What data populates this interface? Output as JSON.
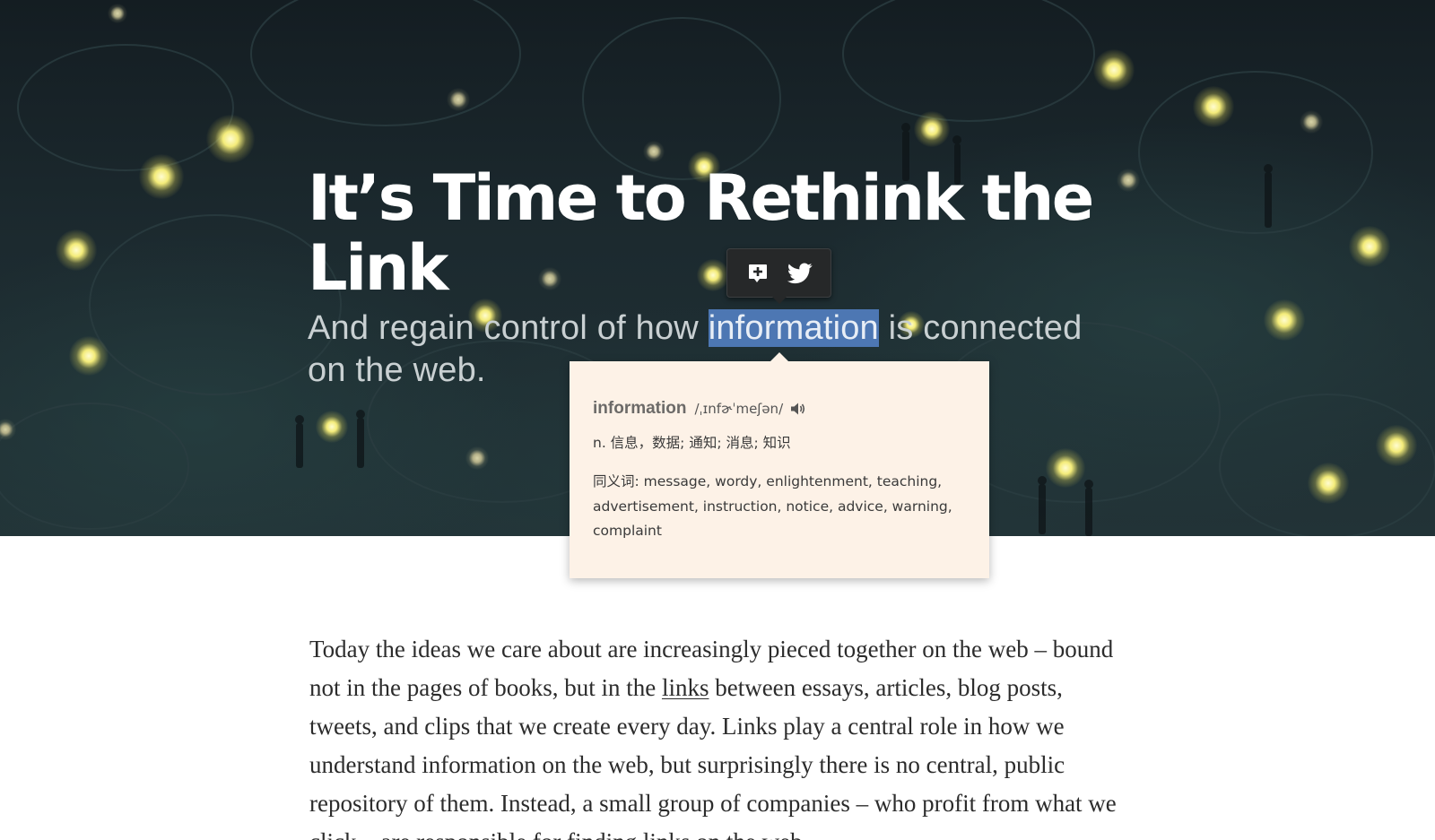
{
  "hero": {
    "title": "It’s Time to Rethink the Link",
    "subtitle_before": "And regain control of how ",
    "subtitle_highlight": "information",
    "subtitle_after": " is connected on the web."
  },
  "share_tooltip": {
    "buttons": [
      {
        "icon": "add-annotation-icon"
      },
      {
        "icon": "twitter-icon"
      }
    ]
  },
  "dictionary": {
    "word": "information",
    "phonetic": "/ˌɪnfɚˈmeʃən/",
    "speaker_icon": "speaker-icon",
    "definition": "n. 信息，数据; 通知; 消息; 知识",
    "synonyms": "同义词: message, wordy, enlightenment, teaching, advertisement, instruction, notice, advice, warning, complaint"
  },
  "article": {
    "para_before_link": "Today the ideas we care about are increasingly pieced together on the web – bound not in the pages of books, but in the ",
    "link_text": "links",
    "para_after_link": " between essays, articles, blog posts, tweets, and clips that we create every day. Links play a central role in how we understand information on the web, but surprisingly there is no central, public repository of them. Instead, a small group of companies – who profit from what we click – are responsible for finding links on the web."
  },
  "colors": {
    "selection_highlight": "#4d77b3",
    "popup_background": "#fdf2e7",
    "tooltip_background": "#262829",
    "glow": "#f4ec7a"
  }
}
